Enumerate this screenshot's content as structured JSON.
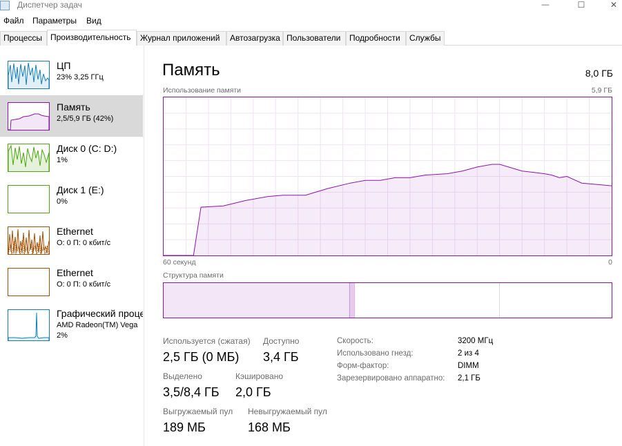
{
  "window": {
    "title": "Диспетчер задач",
    "minimize_glyph": "—",
    "maximize_glyph": "☐",
    "close_glyph": "✕"
  },
  "menu": [
    "Файл",
    "Параметры",
    "Вид"
  ],
  "tabs": [
    {
      "label": "Процессы",
      "active": false
    },
    {
      "label": "Производительность",
      "active": true
    },
    {
      "label": "Журнал приложений",
      "active": false
    },
    {
      "label": "Автозагрузка",
      "active": false
    },
    {
      "label": "Пользователи",
      "active": false
    },
    {
      "label": "Подробности",
      "active": false
    },
    {
      "label": "Службы",
      "active": false
    }
  ],
  "sidebar": {
    "items": [
      {
        "name": "ЦП",
        "sub": "23%  3,25 ГГц",
        "sub2": "",
        "color": "#117dbb",
        "active": false,
        "icon": "cpu-graph-icon"
      },
      {
        "name": "Память",
        "sub": "2,5/5,9 ГБ (42%)",
        "sub2": "",
        "color": "#8b12ae",
        "active": true,
        "icon": "memory-graph-icon"
      },
      {
        "name": "Диск 0 (C: D:)",
        "sub": "1%",
        "sub2": "",
        "color": "#4da60c",
        "active": false,
        "icon": "disk-graph-icon"
      },
      {
        "name": "Диск 1 (E:)",
        "sub": "0%",
        "sub2": "",
        "color": "#4da60c",
        "active": false,
        "icon": "disk-graph-icon"
      },
      {
        "name": "Ethernet",
        "sub": "О: 0 П: 0 кбит/с",
        "sub2": "",
        "color": "#a74f01",
        "active": false,
        "icon": "ethernet-graph-icon"
      },
      {
        "name": "Ethernet",
        "sub": "О: 0 П: 0 кбит/с",
        "sub2": "",
        "color": "#a74f01",
        "active": false,
        "icon": "ethernet-graph-icon"
      },
      {
        "name": "Графический процессор",
        "sub": "AMD Radeon(TM) Vega",
        "sub2": "2%",
        "color": "#117dbb",
        "active": false,
        "icon": "gpu-graph-icon"
      }
    ]
  },
  "main": {
    "title": "Память",
    "total": "8,0 ГБ",
    "usage_label": "Использование памяти",
    "usage_max": "5,9 ГБ",
    "time_left": "60 секунд",
    "time_right": "0",
    "composition_label": "Структура памяти",
    "stats": {
      "in_use_label": "Используется (сжатая)",
      "in_use_value": "2,5 ГБ (0 МБ)",
      "available_label": "Доступно",
      "available_value": "3,4 ГБ",
      "committed_label": "Выделено",
      "committed_value": "3,5/8,4 ГБ",
      "cached_label": "Кэшировано",
      "cached_value": "2,0 ГБ",
      "paged_label": "Выгружаемый пул",
      "paged_value": "189 МБ",
      "nonpaged_label": "Невыгружаемый пул",
      "nonpaged_value": "168 МБ"
    },
    "details": [
      {
        "label": "Скорость:",
        "value": "3200 МГц"
      },
      {
        "label": "Использовано гнезд:",
        "value": "2 из 4"
      },
      {
        "label": "Форм-фактор:",
        "value": "DIMM"
      },
      {
        "label": "Зарезервировано аппаратно:",
        "value": "2,1 ГБ"
      }
    ]
  },
  "chart_data": {
    "type": "area",
    "title": "Использование памяти",
    "xlabel": "",
    "ylabel": "",
    "xlim": [
      60,
      0
    ],
    "ylim": [
      0,
      5.9
    ],
    "x": [
      60,
      56,
      55,
      52,
      49,
      46,
      44,
      41,
      38,
      35,
      33,
      31,
      29,
      27,
      25,
      22,
      20,
      18,
      16,
      15,
      12,
      9,
      8,
      7,
      6,
      4,
      2,
      0
    ],
    "series": [
      {
        "values": [
          0,
          0,
          1.8,
          1.85,
          2.05,
          2.2,
          2.25,
          2.25,
          2.5,
          2.7,
          2.8,
          2.8,
          2.9,
          2.9,
          3.0,
          3.05,
          3.15,
          3.3,
          3.4,
          3.4,
          3.15,
          3.05,
          3.0,
          2.9,
          2.95,
          2.7,
          2.65,
          2.6
        ],
        "color": "#8b12ae"
      }
    ],
    "composition": {
      "in_use_fraction": 0.415,
      "modified_fraction": 0.012,
      "standby_fraction": 0.323,
      "free_fraction": 0.25
    },
    "grid": true
  }
}
